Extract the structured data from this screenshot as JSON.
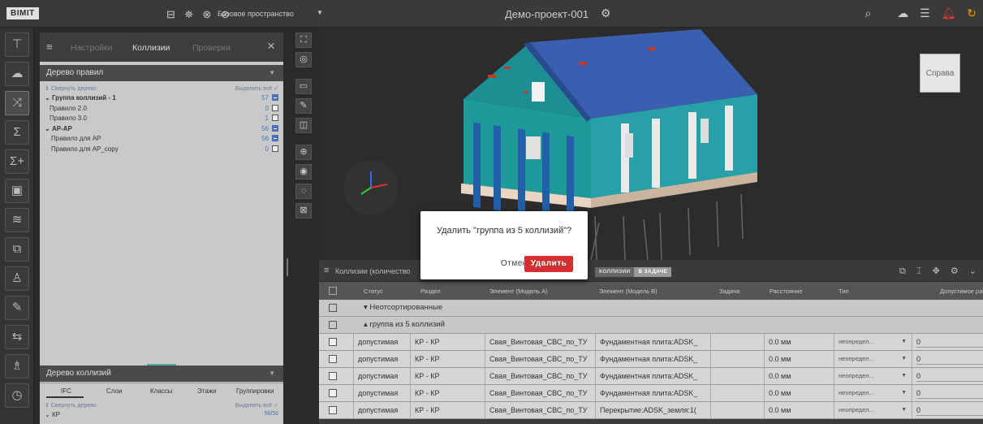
{
  "topbar": {
    "logo": "BIMIT",
    "toolbar_icons": "⊟ ⛯ ⊗ ⊘",
    "space_label": "Базовое пространство",
    "project_title": "Демо-проект-001"
  },
  "sidebar": {
    "items": [
      {
        "icon": "tree-icon",
        "glyph": "⊤"
      },
      {
        "icon": "cloud-icon",
        "glyph": "☁"
      },
      {
        "icon": "shuffle-icon",
        "glyph": "⤨"
      },
      {
        "icon": "sigma-icon",
        "glyph": "Σ"
      },
      {
        "icon": "sigma-plus-icon",
        "glyph": "Σ+"
      },
      {
        "icon": "calendar-icon",
        "glyph": "▣"
      },
      {
        "icon": "chart-icon",
        "glyph": "≋"
      },
      {
        "icon": "puzzle-icon",
        "glyph": "⧉"
      },
      {
        "icon": "person-icon",
        "glyph": "♙"
      },
      {
        "icon": "pen-icon",
        "glyph": "✎"
      },
      {
        "icon": "route-icon",
        "glyph": "⇆"
      },
      {
        "icon": "user-settings-icon",
        "glyph": "♗"
      },
      {
        "icon": "clock-icon",
        "glyph": "◷"
      }
    ]
  },
  "left_panel": {
    "tabs": [
      "Настройки",
      "Коллизии",
      "Проверки"
    ],
    "active_tab": "Коллизии",
    "rules_tree": {
      "title": "Дерево правил",
      "collapse": "Свернуть дерево",
      "select_all": "Выделить всё",
      "rows": [
        {
          "label": "Группа коллизий - 1",
          "count": "57",
          "checked": "true",
          "bold": "true",
          "caret": "⌄"
        },
        {
          "label": "Правило 2.0",
          "count": "0",
          "checked": "false",
          "bold": "false",
          "caret": ""
        },
        {
          "label": "Правило 3.0",
          "count": "1",
          "checked": "false",
          "bold": "false",
          "caret": ""
        },
        {
          "label": "АР-АР",
          "count": "56",
          "checked": "true",
          "bold": "true",
          "caret": "⌄"
        },
        {
          "label": "Правило для АР",
          "count": "56",
          "checked": "true",
          "bold": "false",
          "caret": ""
        },
        {
          "label": "Правило для АР_copy",
          "count": "0",
          "checked": "false",
          "bold": "false",
          "caret": ""
        }
      ]
    },
    "collisions_tree": {
      "title": "Дерево коллизий",
      "tabs": [
        "IFC",
        "Слои",
        "Классы",
        "Этажи",
        "Группировки"
      ],
      "collapse": "Свернуть дерево",
      "select_all": "Выделить всё",
      "first_row": "КР",
      "first_count": "56/56"
    }
  },
  "viewport": {
    "nav_cube_label": "Справа"
  },
  "dialog": {
    "message": "Удалить \"группа из 5 коллизий\"?",
    "cancel": "Отмена",
    "delete": "Удалить"
  },
  "collisions_panel": {
    "title": "Коллизии (количество",
    "filter_pills": [
      "КОЛЛИЗИИ",
      "В ЗАДАЧЕ"
    ],
    "columns": [
      "Статус",
      "Раздел",
      "Элемент (Модель А)",
      "Элемент (Модель В)",
      "Задача",
      "Расстояние",
      "Тип",
      "Допустимое рас"
    ],
    "groups": [
      {
        "label": "Неотсортированные",
        "caret": "▾"
      },
      {
        "label": "группа из 5 коллизий",
        "caret": "▴"
      }
    ],
    "rows": [
      {
        "status": "допустимая",
        "section": "КР - КР",
        "elem_a": "Свая_Винтовая_СВС_по_ТУ",
        "elem_b": "Фундаментная плита:ADSK_",
        "task": "",
        "distance": "0.0 мм",
        "type": "неопредел...",
        "allowed": "0"
      },
      {
        "status": "допустимая",
        "section": "КР - КР",
        "elem_a": "Свая_Винтовая_СВС_по_ТУ",
        "elem_b": "Фундаментная плита:ADSK_",
        "task": "",
        "distance": "0.0 мм",
        "type": "неопредел...",
        "allowed": "0"
      },
      {
        "status": "допустимая",
        "section": "КР - КР",
        "elem_a": "Свая_Винтовая_СВС_по_ТУ",
        "elem_b": "Фундаментная плита:ADSK_",
        "task": "",
        "distance": "0.0 мм",
        "type": "неопредел...",
        "allowed": "0"
      },
      {
        "status": "допустимая",
        "section": "КР - КР",
        "elem_a": "Свая_Винтовая_СВС_по_ТУ",
        "elem_b": "Фундаментная плита:ADSK_",
        "task": "",
        "distance": "0.0 мм",
        "type": "неопредел...",
        "allowed": "0"
      },
      {
        "status": "допустимая",
        "section": "КР - КР",
        "elem_a": "Свая_Винтовая_СВС_по_ТУ",
        "elem_b": "Перекрытие:ADSK_земля:1(",
        "task": "",
        "distance": "0.0 мм",
        "type": "неопредел...",
        "allowed": "0"
      }
    ]
  },
  "colors": {
    "accent_blue": "#4a72b8",
    "danger": "#d32f2f",
    "house_teal": "#1f9a9a",
    "house_blue": "#2160a8",
    "roof_blue": "#3a5fae",
    "foundation": "#e8d6c3"
  }
}
